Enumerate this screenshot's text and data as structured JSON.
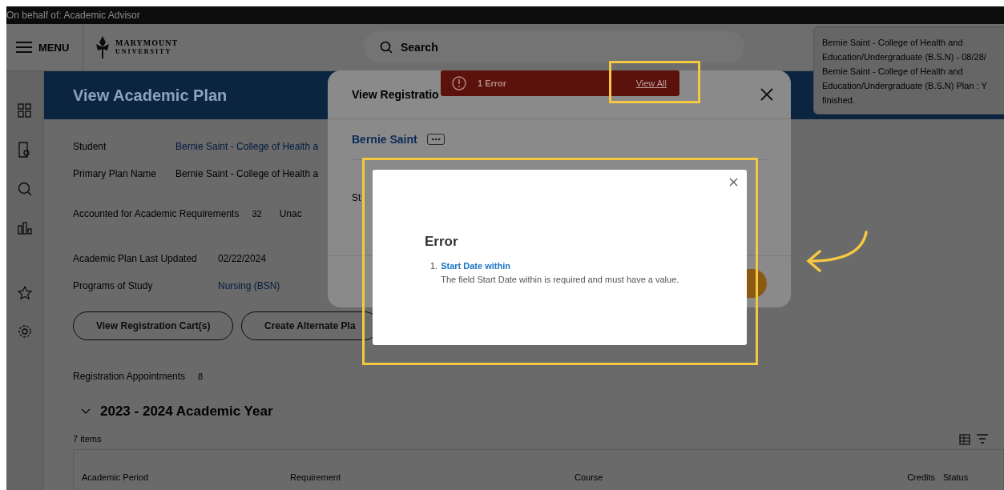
{
  "top_strip": {
    "text": "On behalf of: Academic Advisor"
  },
  "header": {
    "menu_label": "MENU",
    "logo": [
      "MARYMOUNT",
      "UNIVERSITY"
    ],
    "search": {
      "placeholder": "Search"
    }
  },
  "notification": {
    "lines": [
      "Bernie Saint - College of Health and",
      "Education/Undergraduate (B.S.N) - 08/28/",
      "Bernie Saint - College of Health and",
      "Education/Undergraduate (B.S.N) Plan : Y",
      "finished."
    ]
  },
  "page": {
    "title": "View Academic Plan",
    "fields": [
      {
        "label": "Student",
        "value": "Bernie Saint - College of Health a",
        "kind": "link"
      },
      {
        "label": "Primary Plan Name",
        "value": "Bernie Saint - College of Health a",
        "kind": "text"
      }
    ],
    "requirements": {
      "label": "Accounted for Academic Requirements",
      "count": "32",
      "next_label": "Unac"
    },
    "fields2": [
      {
        "label": "Academic Plan Last Updated",
        "value": "02/22/2024",
        "kind": "text"
      },
      {
        "label": "Programs of Study",
        "value": "Nursing (BSN)",
        "kind": "link"
      }
    ],
    "buttons": [
      "View Registration Cart(s)",
      "Create Alternate Pla"
    ],
    "appointments": {
      "label": "Registration Appointments",
      "count": "8"
    },
    "section": {
      "title": "2023 - 2024 Academic Year",
      "expanded": true,
      "count": "7 items"
    },
    "table": {
      "columns": [
        "Academic Period",
        "Requirement",
        "Course",
        "Credits",
        "Status"
      ]
    }
  },
  "modal": {
    "title": "View Registratio",
    "student": "Bernie Saint",
    "field_label": "St"
  },
  "error_banner": {
    "text": "1 Error",
    "link": "View All"
  },
  "error_dialog": {
    "title": "Error",
    "items": [
      {
        "number": "1.",
        "title": "Start Date within",
        "message": "The field Start Date within is required and must have a value."
      }
    ]
  }
}
